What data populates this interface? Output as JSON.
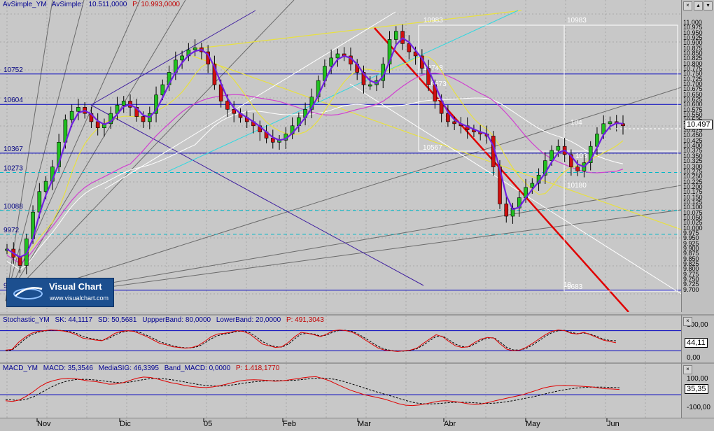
{
  "main": {
    "header": {
      "name": "AvSimple_YM",
      "indicator": "AvSimple:",
      "value": "10.511,0000",
      "price": "P: 10.993,0000"
    },
    "axis_ticks": [
      "11.000",
      "10.975",
      "10.950",
      "10.925",
      "10.900",
      "10.875",
      "10.850",
      "10.825",
      "10.800",
      "10.775",
      "10.750",
      "10.725",
      "10.700",
      "10.675",
      "10.650",
      "10.625",
      "10.600",
      "10.575",
      "10.550",
      "10.525",
      "10.500",
      "10.475",
      "10.450",
      "10.425",
      "10.400",
      "10.375",
      "10.350",
      "10.325",
      "10.300",
      "10.275",
      "10.250",
      "10.225",
      "10.200",
      "10.175",
      "10.150",
      "10.125",
      "10.100",
      "10.075",
      "10.050",
      "10.025",
      "10.000",
      "9.975",
      "9.950",
      "9.925",
      "9.900",
      "9.875",
      "9.850",
      "9.825",
      "9.800",
      "9.775",
      "9.750",
      "9.725",
      "9.700"
    ],
    "last_price": "10.497",
    "left_levels": [
      "10752",
      "10604",
      "10367",
      "10273",
      "10088",
      "9972",
      "9"
    ],
    "chart_labels": [
      "10983",
      "10983",
      "10748",
      "10673",
      "10567",
      "10180",
      "9683",
      "104",
      "103",
      "10"
    ]
  },
  "stochastic": {
    "header": {
      "name": "Stochastic_YM",
      "sk": "SK: 44,1117",
      "sd": "SD: 50,5681",
      "upper": "UppperBand: 80,0000",
      "lower": "LowerBand: 20,0000",
      "price": "P: 491,3043"
    },
    "axis_ticks": [
      "100,00",
      "50,00",
      "0,00"
    ],
    "last": "44,11",
    "chart_data": {
      "type": "line",
      "ylim": [
        0,
        100
      ],
      "bands": [
        80,
        20
      ],
      "series": [
        {
          "name": "SK",
          "values": [
            22,
            24,
            45,
            60,
            72,
            78,
            80,
            82,
            81,
            79,
            75,
            68,
            58,
            55,
            52,
            50,
            60,
            72,
            78,
            80,
            78,
            70,
            62,
            52,
            42,
            38,
            32,
            30,
            28,
            30,
            36,
            48,
            62,
            70,
            72,
            75,
            80,
            78,
            70,
            55,
            40,
            35,
            30,
            32,
            45,
            62,
            75,
            72,
            68,
            62,
            70,
            80,
            82,
            80,
            75,
            65,
            52,
            40,
            28,
            22,
            20,
            18,
            20,
            22,
            28,
            42,
            55,
            68,
            62,
            48,
            35,
            30,
            32,
            45,
            55,
            60,
            58,
            40,
            25,
            20,
            22,
            30,
            42,
            55,
            68,
            78,
            82,
            80,
            72,
            70,
            75,
            68,
            60,
            52,
            48,
            44
          ]
        },
        {
          "name": "SD",
          "values": [
            20,
            22,
            38,
            55,
            68,
            75,
            79,
            81,
            81,
            80,
            77,
            72,
            63,
            58,
            54,
            51,
            56,
            67,
            75,
            79,
            79,
            74,
            66,
            57,
            47,
            41,
            35,
            31,
            29,
            29,
            33,
            43,
            56,
            65,
            70,
            73,
            78,
            79,
            74,
            62,
            47,
            38,
            32,
            31,
            40,
            56,
            70,
            72,
            70,
            64,
            67,
            76,
            81,
            81,
            77,
            69,
            57,
            45,
            33,
            25,
            21,
            19,
            19,
            21,
            26,
            37,
            50,
            63,
            64,
            53,
            40,
            33,
            31,
            40,
            51,
            58,
            59,
            46,
            30,
            23,
            22,
            27,
            37,
            50,
            63,
            74,
            80,
            81,
            75,
            71,
            73,
            70,
            63,
            55,
            51,
            50
          ]
        }
      ]
    }
  },
  "macd": {
    "header": {
      "name": "MACD_YM",
      "macd": "MACD: 35,3546",
      "signal": "MediaSIG: 46,3395",
      "band": "Band_MACD: 0,0000",
      "price": "P: 1.418,1770"
    },
    "axis_ticks": [
      "100,00",
      "35,35",
      "-100,00"
    ],
    "last": "35,35",
    "chart_data": {
      "type": "line",
      "ylim": [
        -130,
        150
      ],
      "band": 0,
      "series": [
        {
          "name": "MACD",
          "values": [
            -40,
            -45,
            -35,
            -10,
            20,
            55,
            80,
            95,
            105,
            110,
            108,
            100,
            92,
            88,
            80,
            70,
            72,
            80,
            95,
            110,
            118,
            115,
            105,
            92,
            80,
            72,
            62,
            55,
            50,
            48,
            52,
            60,
            70,
            82,
            92,
            98,
            100,
            98,
            95,
            90,
            92,
            98,
            105,
            112,
            118,
            120,
            108,
            92,
            70,
            50,
            30,
            15,
            0,
            -10,
            -20,
            -30,
            -45,
            -60,
            -70,
            -72,
            -68,
            -60,
            -50,
            -42,
            -40,
            -45,
            -52,
            -60,
            -65,
            -62,
            -52,
            -40,
            -30,
            -20,
            -10,
            0,
            15,
            30,
            45,
            55,
            60,
            62,
            60,
            58,
            55,
            52,
            45,
            40,
            38,
            35
          ]
        },
        {
          "name": "MediaSIG",
          "values": [
            -30,
            -35,
            -38,
            -30,
            -15,
            10,
            35,
            60,
            78,
            92,
            100,
            103,
            102,
            98,
            93,
            87,
            82,
            80,
            84,
            92,
            101,
            107,
            109,
            106,
            100,
            93,
            85,
            76,
            68,
            62,
            58,
            57,
            60,
            66,
            73,
            80,
            86,
            90,
            93,
            94,
            94,
            95,
            97,
            101,
            106,
            110,
            111,
            108,
            100,
            89,
            75,
            60,
            45,
            30,
            16,
            3,
            -10,
            -24,
            -38,
            -50,
            -58,
            -62,
            -61,
            -58,
            -54,
            -51,
            -50,
            -51,
            -54,
            -57,
            -58,
            -56,
            -51,
            -44,
            -36,
            -27,
            -18,
            -8,
            3,
            14,
            24,
            33,
            40,
            45,
            49,
            51,
            51,
            50,
            49,
            46
          ]
        }
      ]
    }
  },
  "time_axis": [
    "Nov",
    "Dic",
    "05",
    "Feb",
    "Mar",
    "Abr",
    "May",
    "Jun"
  ],
  "logo": {
    "title": "Visual Chart",
    "url": "www.visualchart.com"
  },
  "chart_data": {
    "type": "line",
    "title": "AvSimple_YM",
    "ylim": [
      9665,
      11010
    ],
    "series": [
      {
        "name": "AvSimple_YM",
        "values": [
          9900,
          9860,
          9820,
          9950,
          10080,
          10180,
          10230,
          10300,
          10420,
          10530,
          10570,
          10590,
          10560,
          10520,
          10490,
          10510,
          10560,
          10600,
          10620,
          10590,
          10545,
          10520,
          10560,
          10650,
          10700,
          10760,
          10820,
          10840,
          10870,
          10880,
          10860,
          10800,
          10700,
          10620,
          10580,
          10560,
          10540,
          10520,
          10500,
          10470,
          10440,
          10420,
          10430,
          10460,
          10500,
          10540,
          10580,
          10640,
          10720,
          10790,
          10830,
          10850,
          10840,
          10800,
          10760,
          10700,
          10700,
          10720,
          10800,
          10920,
          10960,
          10900,
          10860,
          10840,
          10780,
          10700,
          10620,
          10560,
          10520,
          10510,
          10500,
          10480,
          10470,
          10460,
          10450,
          10300,
          10120,
          10060,
          10100,
          10150,
          10200,
          10220,
          10260,
          10330,
          10380,
          10400,
          10360,
          10300,
          10280,
          10320,
          10400,
          10460,
          10510,
          10520,
          10510,
          10500
        ]
      }
    ],
    "levels": [
      10752,
      10604,
      10367,
      10273,
      10088,
      9972,
      9700
    ]
  }
}
